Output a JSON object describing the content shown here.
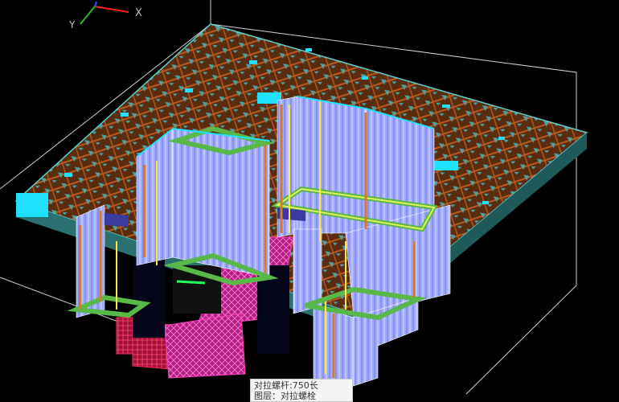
{
  "ucs": {
    "x_label": "X",
    "y_label": "Y",
    "x_axis_color": "#ff2020",
    "y_axis_color": "#20c020"
  },
  "viewport": {
    "background": "#000000",
    "colors": {
      "slab_wood": "#5a2c10",
      "slab_teal": "#4aa3a3",
      "wall_formwork": "#a0aaff",
      "timber_orange": "#d87a2a",
      "steel_green": "#58b848",
      "cyan_rebar": "#20e0ff",
      "magenta_frame": "#ff40c0",
      "red_frame": "#e0204a",
      "yellow_bolt": "#ffe640",
      "navy_fill": "#3a3aa0"
    }
  },
  "tooltip": {
    "line1": "对拉螺杆:750长",
    "line2": "图层：对拉螺栓"
  }
}
